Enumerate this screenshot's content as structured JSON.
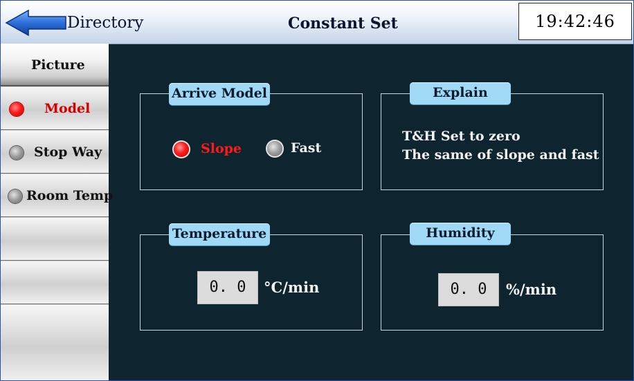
{
  "header": {
    "directory_label": "Directory",
    "title": "Constant Set",
    "clock": "19:42:46"
  },
  "sidebar": {
    "items": [
      {
        "label": "Picture",
        "indicator": "none"
      },
      {
        "label": "Model",
        "indicator": "red"
      },
      {
        "label": "Stop Way",
        "indicator": "grey"
      },
      {
        "label": "Room Temp",
        "indicator": "grey"
      },
      {
        "label": "",
        "indicator": "none"
      },
      {
        "label": "",
        "indicator": "none"
      },
      {
        "label": "",
        "indicator": "none"
      }
    ]
  },
  "arrive_model": {
    "title": "Arrive Model",
    "options": [
      {
        "label": "Slope",
        "selected": true
      },
      {
        "label": "Fast",
        "selected": false
      }
    ]
  },
  "explain": {
    "title": "Explain",
    "lines": [
      "T&H Set to zero",
      "The same of slope and fast"
    ]
  },
  "temperature": {
    "title": "Temperature",
    "value": "0. 0",
    "unit": "°C/min"
  },
  "humidity": {
    "title": "Humidity",
    "value": "0. 0",
    "unit": "%/min"
  },
  "colors": {
    "background": "#0e2530",
    "group_title": "#9fd9f5",
    "selected": "#ff1a1a",
    "active_label": "#d40000"
  }
}
